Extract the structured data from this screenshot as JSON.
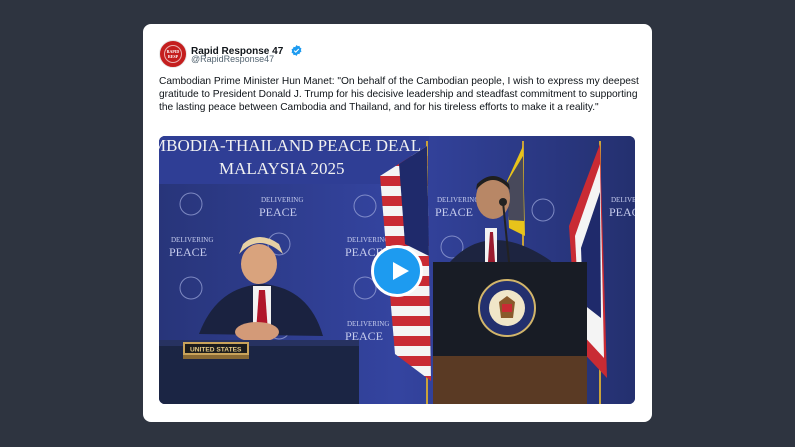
{
  "post": {
    "author_name": "Rapid Response 47",
    "author_handle": "@RapidResponse47",
    "avatar_text": "RAPID RESPONSE 47",
    "verified": true,
    "text": "Cambodian Prime Minister Hun Manet: \"On behalf of the Cambodian people, I wish to express my deepest gratitude to President Donald J. Trump for his decisive leadership and steadfast commitment to supporting the lasting peace between Cambodia and Thailand, and for his tireless efforts to make it a reality.\""
  },
  "video": {
    "banner_line1": "MBODIA-THAILAND PEACE DEAL",
    "banner_line2": "MALAYSIA 2025",
    "backdrop_text_1": "DELIVERING",
    "backdrop_text_2": "PEACE",
    "name_plate": "UNITED STATES",
    "play_button_icon": "play-icon"
  },
  "colors": {
    "page_background": "#2e3440",
    "card_background": "#ffffff",
    "verified_blue": "#1d9bf0",
    "backdrop_blue": "#2c3a88"
  }
}
